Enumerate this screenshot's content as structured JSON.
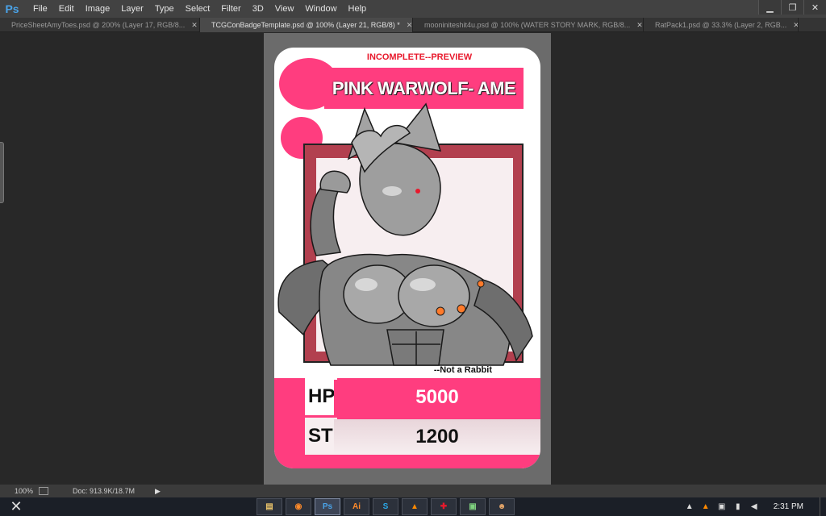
{
  "app": {
    "logo": "Ps",
    "menu": [
      "File",
      "Edit",
      "Image",
      "Layer",
      "Type",
      "Select",
      "Filter",
      "3D",
      "View",
      "Window",
      "Help"
    ],
    "window_controls": [
      "minimize-icon",
      "restore-icon",
      "close-icon"
    ]
  },
  "tabs": [
    {
      "label": "PriceSheetAmyToes.psd @ 200% (Layer 17, RGB/8...",
      "active": false
    },
    {
      "label": "TCGConBadgeTemplate.psd @ 100% (Layer 21, RGB/8) *",
      "active": true
    },
    {
      "label": "mooniniteshit4u.psd @ 100% (WATER STORY MARK, RGB/8...",
      "active": false
    },
    {
      "label": "RatPack1.psd @ 33.3% (Layer 2, RGB...",
      "active": false
    }
  ],
  "card": {
    "status": "INCOMPLETE--PREVIEW",
    "name": "PINK WARWOLF- AME",
    "subtitle": "--Not a Rabbit",
    "stats": {
      "hp_label": "HP",
      "hp_value": "5000",
      "str_label": "STR",
      "str_value": "1200"
    },
    "colors": {
      "accent": "#ff3d7f",
      "frame": "#b2404f",
      "banner_text": "#e8192c"
    }
  },
  "statusbar": {
    "zoom": "100%",
    "doc": "Doc: 913.9K/18.7M"
  },
  "taskbar": {
    "apps": [
      {
        "icon": "file-explorer-icon",
        "glyph": "▤"
      },
      {
        "icon": "firefox-icon",
        "glyph": "◉"
      },
      {
        "icon": "photoshop-icon",
        "glyph": "Ps"
      },
      {
        "icon": "illustrator-icon",
        "glyph": "Ai"
      },
      {
        "icon": "skype-icon",
        "glyph": "S"
      },
      {
        "icon": "vlc-icon",
        "glyph": "▲"
      },
      {
        "icon": "app-icon",
        "glyph": "✚"
      },
      {
        "icon": "remote-desktop-icon",
        "glyph": "▣"
      },
      {
        "icon": "game-icon",
        "glyph": "☻"
      }
    ],
    "clock": "2:31 PM"
  }
}
